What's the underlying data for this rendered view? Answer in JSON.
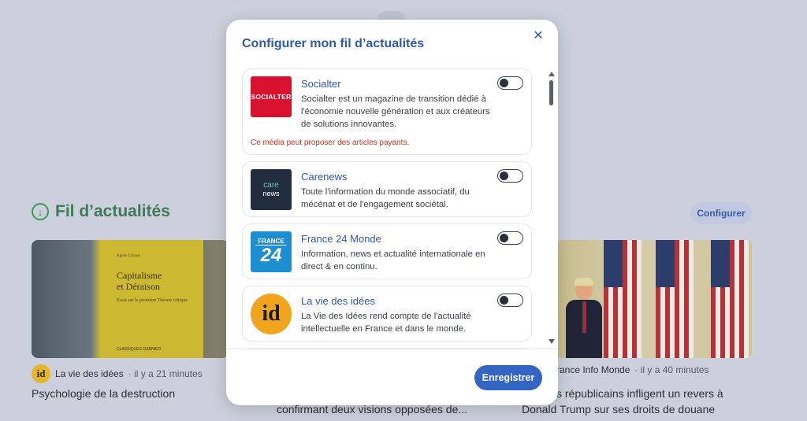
{
  "background": {
    "section_title": "Fil d’actualités",
    "configure_label": "Configurer",
    "cards": [
      {
        "source": "La vie des idées",
        "time": "· il y a 21 minutes",
        "headline": "Psychologie de la destruction",
        "image": {
          "author": "Agnès Grivaux",
          "title_line1": "Capitalisme",
          "title_line2": "et Déraison",
          "subtitle": "Essai sur la première Théorie critique",
          "publisher": "CLASSIQUES GARNIER"
        }
      },
      {
        "source": "",
        "time": "",
        "headline": "confirmant deux visions opposées de..."
      },
      {
        "source": "rance Info Monde",
        "time": "· il y a 40 minutes",
        "headline_line1": "s républicains infligent un revers à",
        "headline_line2": "Donald Trump sur ses droits de douane"
      }
    ]
  },
  "modal": {
    "title": "Configurer mon fil d’actualités",
    "close_icon": "close-icon",
    "save_label": "Enregistrer",
    "items": [
      {
        "name": "Socialter",
        "logo_text": "SOCIALTER",
        "description": "Socialter est un magazine de transition dédié à l'économie nouvelle génération et aux créateurs de solutions innovantes.",
        "warning": "Ce média peut proposer des articles payants.",
        "enabled": false
      },
      {
        "name": "Carenews",
        "logo_line1": "care",
        "logo_line2": "news",
        "description": "Toute l'information du monde associatif, du mécénat et de l'engagement sociétal.",
        "enabled": false
      },
      {
        "name": "France 24 Monde",
        "logo_line1": "FRANCE",
        "logo_line2": "24",
        "description": "Information, news et actualité internationale en direct & en continu.",
        "enabled": false
      },
      {
        "name": "La vie des idées",
        "logo_text": "id",
        "description": "La Vie des Idées rend compte de l'actualité intellectuelle en France et dans le monde.",
        "enabled": false
      }
    ]
  },
  "colors": {
    "accent": "#3259a8",
    "save_button": "#3265c4",
    "warning": "#c0392b",
    "section_green": "#3f7a55"
  }
}
